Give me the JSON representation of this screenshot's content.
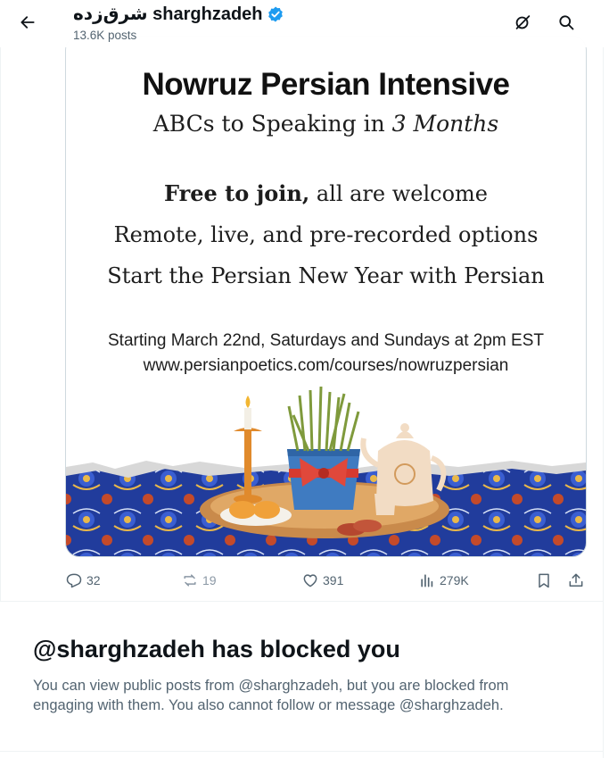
{
  "header": {
    "display_name": "شرق‌زده sharghzadeh",
    "post_count": "13.6K posts"
  },
  "post": {
    "image": {
      "title": "Nowruz Persian Intensive",
      "subtitle_prefix": "ABCs to Speaking in ",
      "subtitle_em": "3 Months",
      "line1_bold": "Free to join,",
      "line1_rest": " all are welcome",
      "line2": "Remote, live, and pre-recorded options",
      "line3": "Start the Persian New Year with Persian",
      "schedule": "Starting March 22nd, Saturdays and Sundays at 2pm EST",
      "url": "www.persianpoetics.com/courses/nowruzpersian"
    },
    "actions": {
      "replies": "32",
      "reposts": "19",
      "likes": "391",
      "views": "279K"
    }
  },
  "blocked": {
    "title": "@sharghzadeh has blocked you",
    "message": "You can view public posts from @sharghzadeh, but you are blocked from engaging with them. You also cannot follow or message @sharghzadeh."
  },
  "colors": {
    "verified_badge": "#1d9bf0",
    "secondary_text": "#536471",
    "repost_disabled": "#8b98a5"
  }
}
